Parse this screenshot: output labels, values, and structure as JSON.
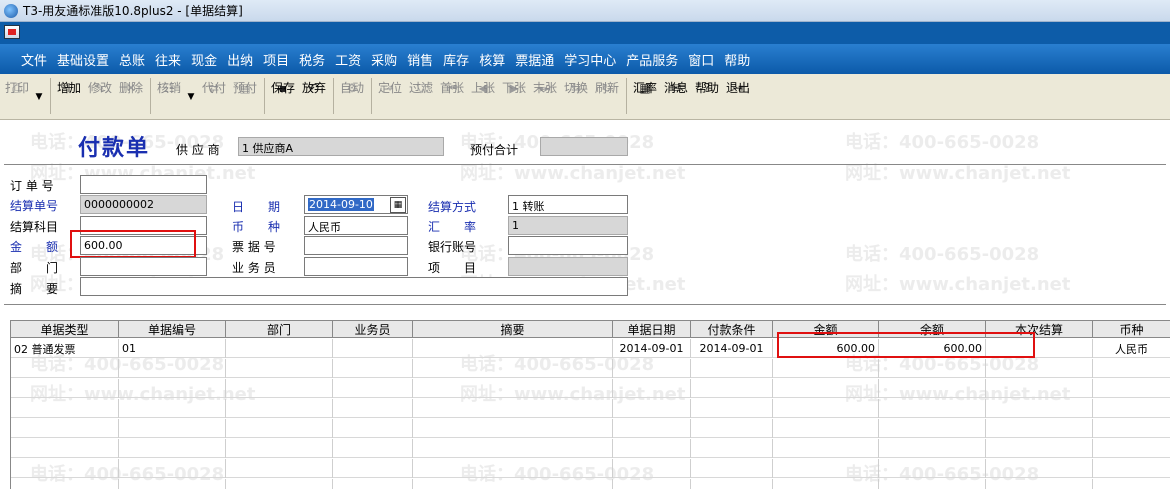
{
  "window": {
    "title": "T3-用友通标准版10.8plus2 - [单据结算]"
  },
  "menu": [
    "文件",
    "基础设置",
    "总账",
    "往来",
    "现金",
    "出纳",
    "项目",
    "税务",
    "工资",
    "采购",
    "销售",
    "库存",
    "核算",
    "票据通",
    "学习中心",
    "产品服务",
    "窗口",
    "帮助"
  ],
  "toolbar": [
    {
      "label": "打印",
      "icon": "print-icon",
      "enabled": false
    },
    {
      "label": "增加",
      "icon": "add-icon",
      "enabled": true
    },
    {
      "label": "修改",
      "icon": "edit-icon",
      "enabled": false
    },
    {
      "label": "删除",
      "icon": "delete-icon",
      "enabled": false
    },
    {
      "label": "核销",
      "icon": "verify-icon",
      "enabled": false
    },
    {
      "label": "代付",
      "icon": "agent-pay-icon",
      "enabled": false
    },
    {
      "label": "预付",
      "icon": "prepay-icon",
      "enabled": false
    },
    {
      "label": "保存",
      "icon": "save-icon",
      "enabled": true
    },
    {
      "label": "放弃",
      "icon": "discard-icon",
      "enabled": true
    },
    {
      "label": "自动",
      "icon": "auto-icon",
      "enabled": false
    },
    {
      "label": "定位",
      "icon": "locate-icon",
      "enabled": false
    },
    {
      "label": "过滤",
      "icon": "filter-icon",
      "enabled": false
    },
    {
      "label": "首张",
      "icon": "first-icon",
      "enabled": false
    },
    {
      "label": "上张",
      "icon": "prev-icon",
      "enabled": false
    },
    {
      "label": "下张",
      "icon": "next-icon",
      "enabled": false
    },
    {
      "label": "末张",
      "icon": "last-icon",
      "enabled": false
    },
    {
      "label": "切换",
      "icon": "switch-icon",
      "enabled": false
    },
    {
      "label": "刷新",
      "icon": "refresh-icon",
      "enabled": false
    },
    {
      "label": "汇率",
      "icon": "rate-icon",
      "enabled": true
    },
    {
      "label": "消息",
      "icon": "message-icon",
      "enabled": true
    },
    {
      "label": "帮助",
      "icon": "help-icon",
      "enabled": true
    },
    {
      "label": "退出",
      "icon": "exit-icon",
      "enabled": true
    }
  ],
  "form": {
    "title": "付款单",
    "supplier_label": "供 应 商",
    "supplier_value": "1  供应商A",
    "prepay_total_label": "预付合计",
    "prepay_total_value": "",
    "order_no_label": "订 单 号",
    "order_no_value": "",
    "settle_no_label": "结算单号",
    "settle_no_value": "0000000002",
    "settle_subject_label": "结算科目",
    "settle_subject_value": "",
    "amount_label_1": "金",
    "amount_label_2": "额",
    "amount_value": "600.00",
    "dept_label_1": "部",
    "dept_label_2": "门",
    "dept_value": "",
    "summary_label_1": "摘",
    "summary_label_2": "要",
    "summary_value": "",
    "date_label_1": "日",
    "date_label_2": "期",
    "date_value": "2014-09-10",
    "currency_label_1": "币",
    "currency_label_2": "种",
    "currency_value": "人民币",
    "bill_no_label": "票 据 号",
    "bill_no_value": "",
    "salesman_label": "业 务 员",
    "salesman_value": "",
    "settle_method_label": "结算方式",
    "settle_method_value": "1    转账",
    "rate_label_1": "汇",
    "rate_label_2": "率",
    "rate_value": "1",
    "bank_account_label": "银行账号",
    "bank_account_value": "",
    "project_label_1": "项",
    "project_label_2": "目",
    "project_value": ""
  },
  "grid": {
    "columns": [
      "单据类型",
      "单据编号",
      "部门",
      "业务员",
      "摘要",
      "单据日期",
      "付款条件",
      "金额",
      "余额",
      "本次结算",
      "币种"
    ],
    "rows": [
      [
        "02    普通发票",
        "01",
        "",
        "",
        "",
        "2014-09-01",
        "2014-09-01",
        "600.00",
        "600.00",
        "",
        "人民币"
      ]
    ]
  },
  "watermark": {
    "phone": "电话：400-665-0028",
    "site": "网址：www.chanjet.net"
  },
  "colors": {
    "title_blue": "#1a2fb0",
    "menu_blue": "#0c5aa9",
    "highlight_red": "#e01010",
    "readonly_gray": "#d7d7d7"
  }
}
